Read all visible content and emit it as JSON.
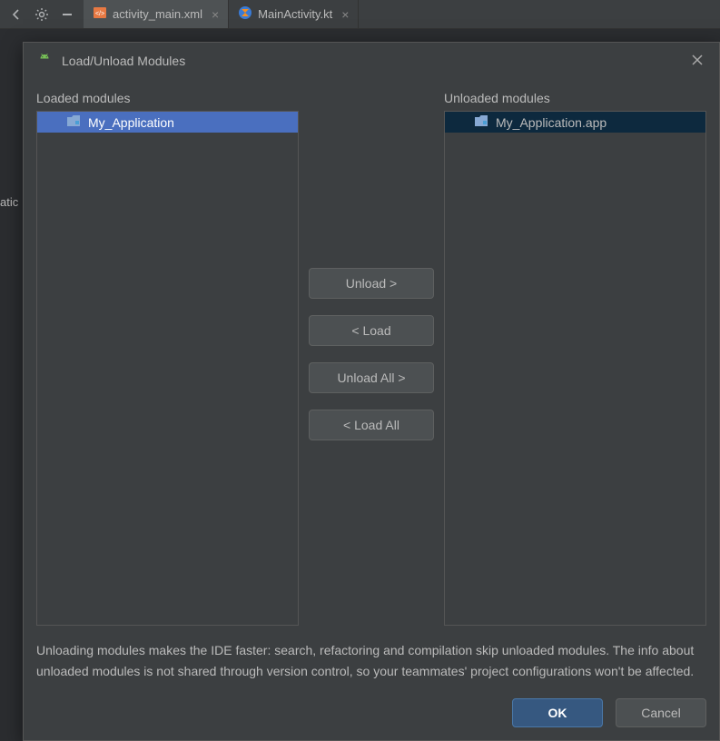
{
  "tabs": [
    {
      "label": "activity_main.xml",
      "type": "xml"
    },
    {
      "label": "MainActivity.kt",
      "type": "kt"
    }
  ],
  "side_fragment": "atic",
  "dialog": {
    "title": "Load/Unload Modules",
    "loaded": {
      "label": "Loaded modules",
      "items": [
        "My_Application"
      ]
    },
    "unloaded": {
      "label": "Unloaded modules",
      "items": [
        "My_Application.app"
      ]
    },
    "buttons": {
      "unload": "Unload >",
      "load": "< Load",
      "unload_all": "Unload All >",
      "load_all": "< Load All"
    },
    "info": "Unloading modules makes the IDE faster: search, refactoring and compilation skip unloaded modules. The info about unloaded modules is not shared through version control, so your teammates' project configurations won't be affected.",
    "ok": "OK",
    "cancel": "Cancel"
  }
}
